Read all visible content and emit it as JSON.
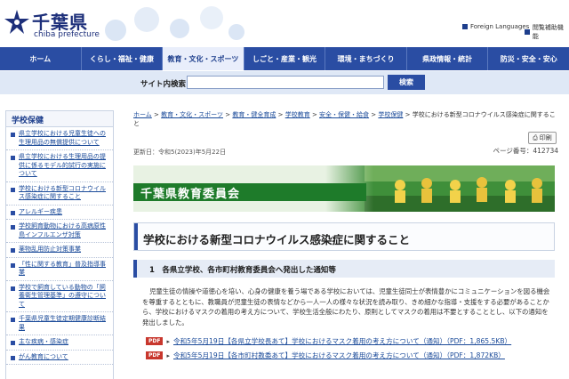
{
  "header": {
    "title": "千葉県",
    "subtitle": "chiba prefecture",
    "foreign_languages": "Foreign Languages",
    "accessibility": "閲覧補助機能"
  },
  "nav": {
    "items": [
      {
        "label": "ホーム"
      },
      {
        "label": "くらし・福祉・健康"
      },
      {
        "label": "教育・文化・スポーツ"
      },
      {
        "label": "しごと・産業・観光"
      },
      {
        "label": "環境・まちづくり"
      },
      {
        "label": "県政情報・統計"
      },
      {
        "label": "防災・安全・安心"
      }
    ],
    "active_index": 2
  },
  "search": {
    "label": "サイト内検索",
    "button": "検索",
    "placeholder": ""
  },
  "sidebar": {
    "heading": "学校保健",
    "items": [
      {
        "label": "県立学校における児童生徒への生理用品の無償提供について"
      },
      {
        "label": "県立学校における生理用品の提供に係るモデル的試行の実施について"
      },
      {
        "label": "学校における新型コロナウイルス感染症に関すること"
      },
      {
        "label": "アレルギー疾患"
      },
      {
        "label": "学校飼育動物における高病原性鳥インフルエンザ対策"
      },
      {
        "label": "薬物乱用防止対策事業"
      },
      {
        "label": "「性に関する教育」普及指導事業"
      },
      {
        "label": "学校で飼育している動物の「飼養衛生管理基準」の遵守について"
      },
      {
        "label": "千葉県児童生徒定期健康診断結果"
      },
      {
        "label": "主な疾病・感染症"
      },
      {
        "label": "がん教育について"
      }
    ]
  },
  "breadcrumb": {
    "items": [
      "ホーム",
      "教育・文化・スポーツ",
      "教育・健全育成",
      "学校教育",
      "安全・保健・給食",
      "学校保健"
    ],
    "current": "学校における新型コロナウイルス感染症に関すること",
    "separator": ">"
  },
  "meta": {
    "updated": "更新日：令和5(2023)年5月22日",
    "page_id": "ページ番号：412734",
    "print_label": "印刷"
  },
  "banner": {
    "title": "千葉県教育委員会"
  },
  "page_title": "学校における新型コロナウイルス感染症に関すること",
  "section": {
    "heading": "1　各県立学校、各市町村教育委員会へ発出した通知等",
    "body": "児童生徒の情操や道徳心を培い、心身の健康を養う場である学校においては、児童生徒同士が表情豊かにコミュニケーションを図る機会を尊重するとともに、教職員が児童生徒の表情などから一人一人の様々な状況を読み取り、きめ細かな指導・支援をする必要があることから、学校におけるマスクの着用の考え方について、学校生活全般にわたり、原則としてマスクの着用は不要とすることとし、以下の通知を発出しました。",
    "links": [
      {
        "badge": "PDF",
        "label": "令和5年5月19日【各県立学校長あて】学校におけるマスク着用の考え方について（通知）（PDF：1,865.5KB）"
      },
      {
        "badge": "PDF",
        "label": "令和5年5月19日【各市町村教委あて】学校におけるマスク着用の考え方について（通知）（PDF：1,872KB）"
      }
    ]
  },
  "colors": {
    "brand": "#1d2f7a",
    "nav_bg": "#2a4da3",
    "search_bg": "#dfe8f6",
    "banner_green": "#1e7b2a",
    "pdf_red": "#c8372d",
    "link": "#1a4a99"
  }
}
